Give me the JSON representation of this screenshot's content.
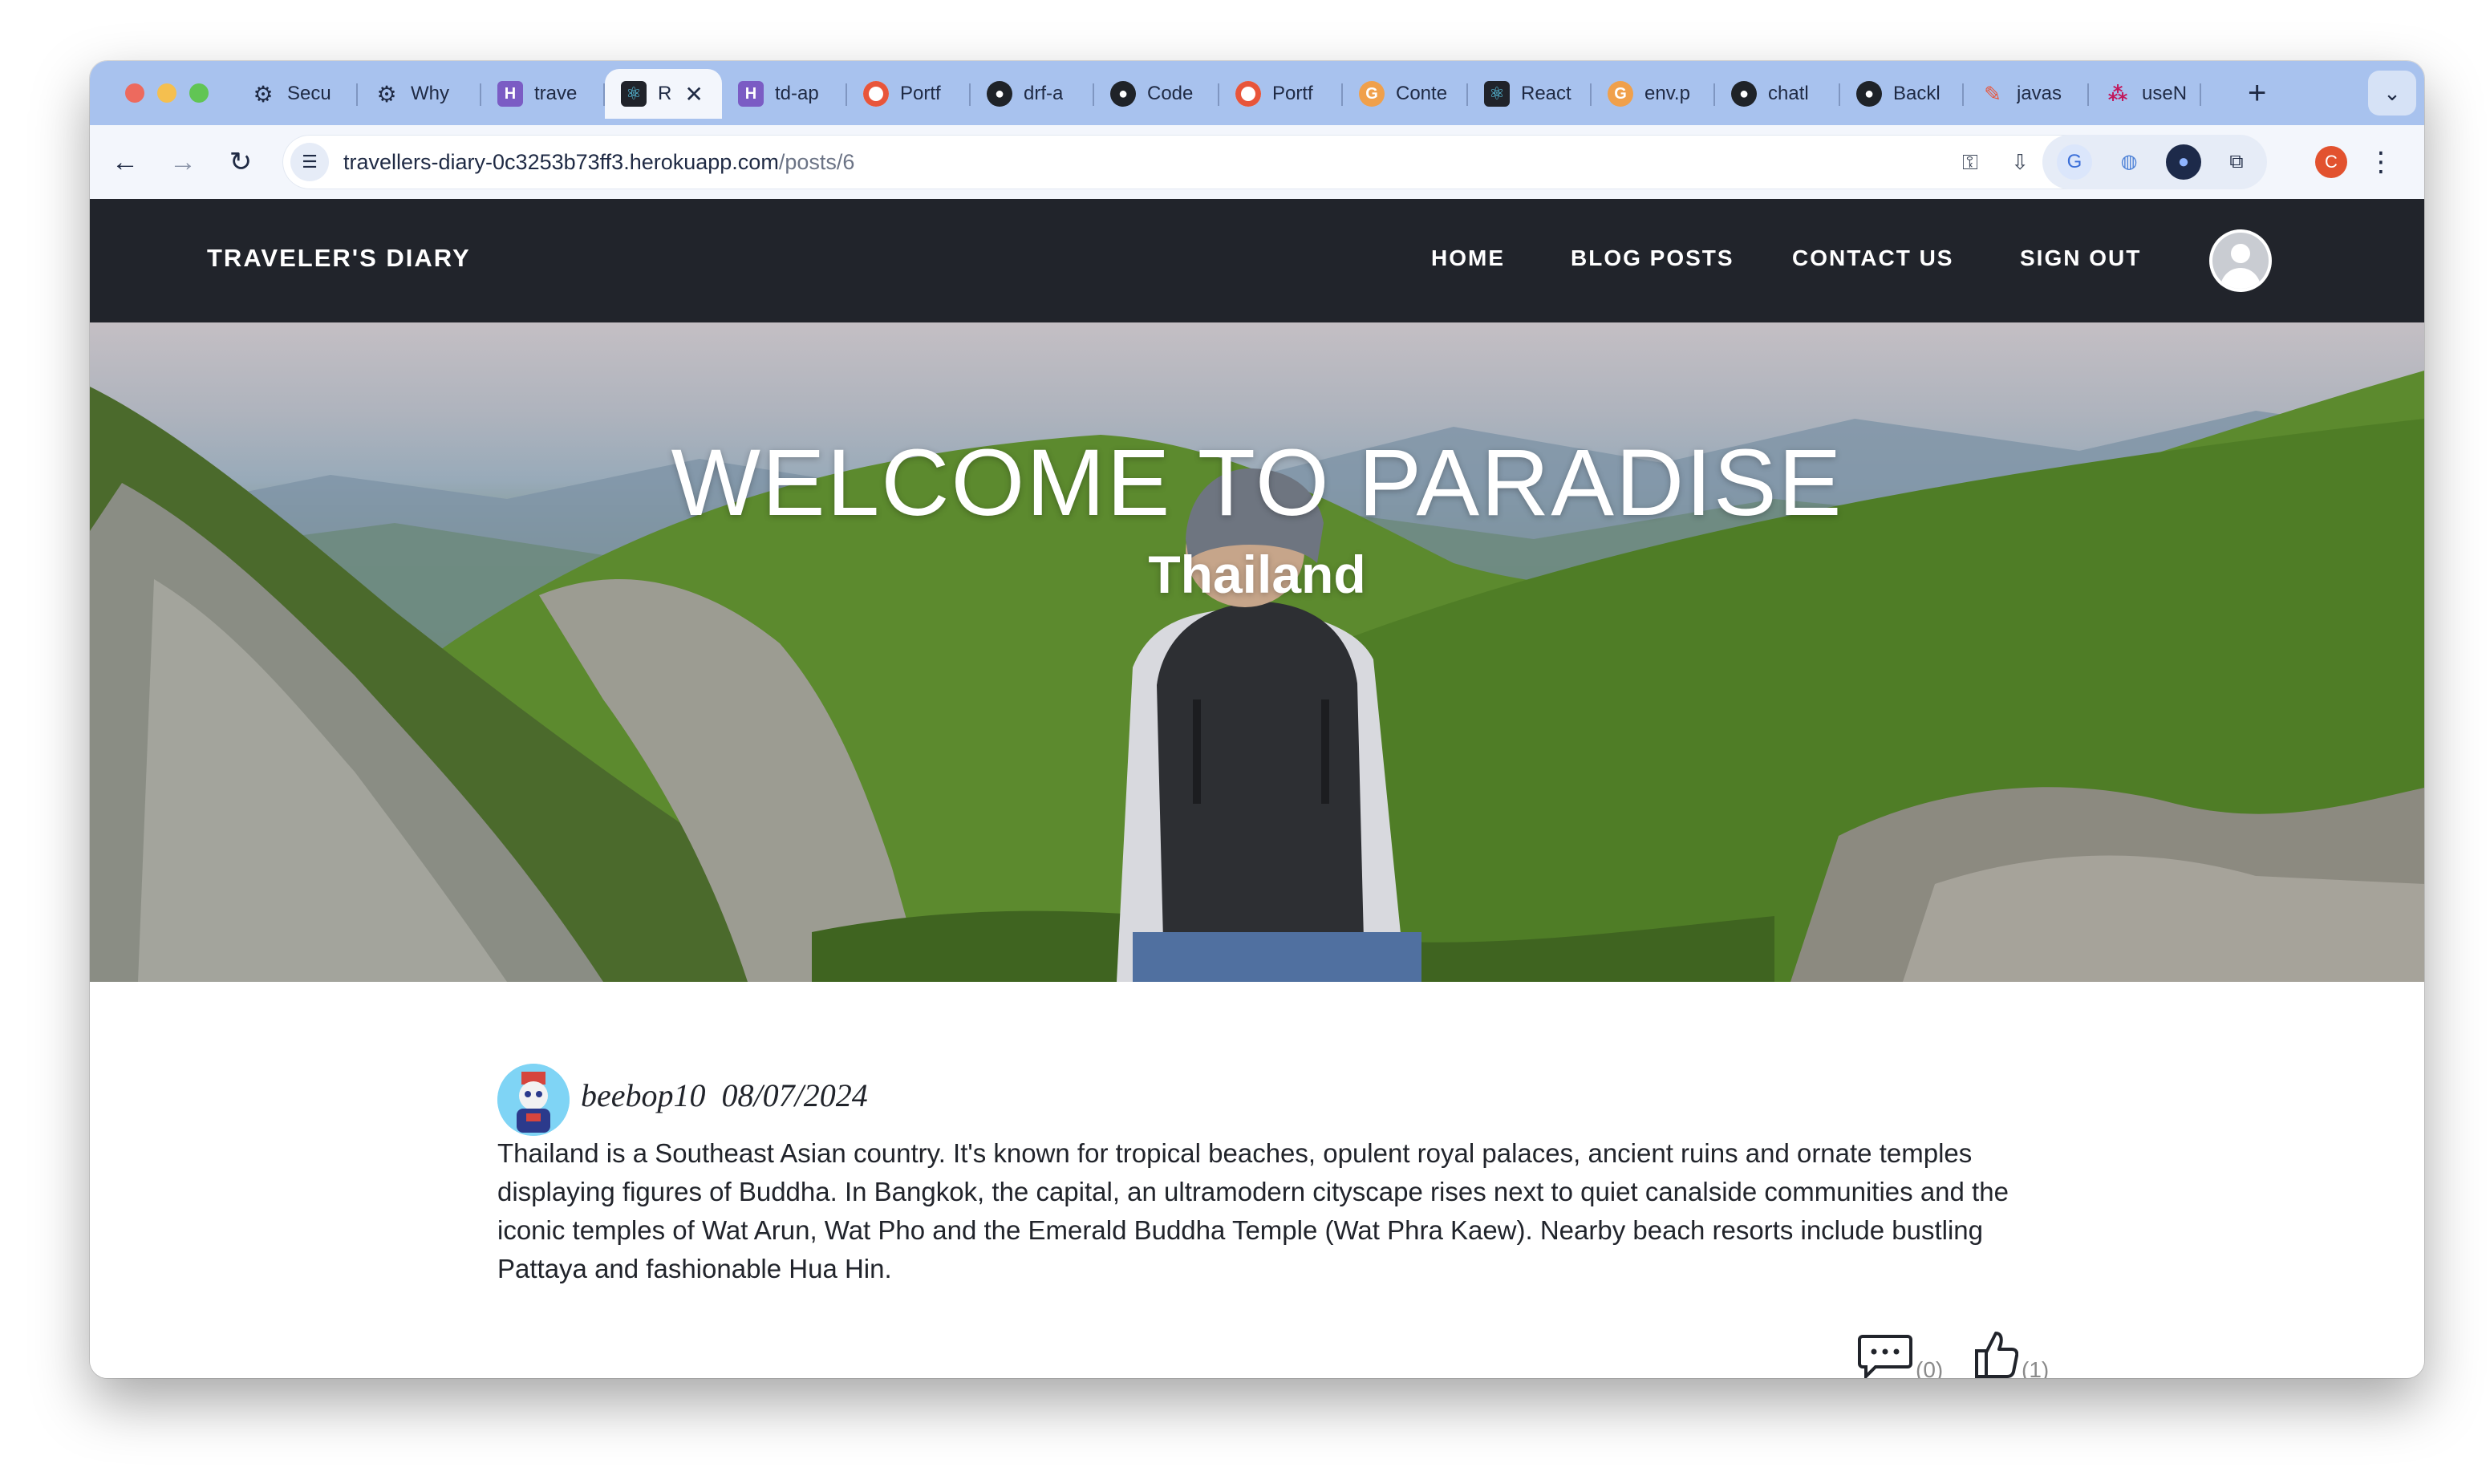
{
  "browser": {
    "tabs": [
      {
        "title": "Secu",
        "icon": "openai-icon"
      },
      {
        "title": "Why",
        "icon": "openai-icon"
      },
      {
        "title": "trave",
        "icon": "heroku-icon"
      },
      {
        "title": "R",
        "icon": "react-icon",
        "active": true
      },
      {
        "title": "td-ap",
        "icon": "heroku-icon"
      },
      {
        "title": "Portf",
        "icon": "ring-icon"
      },
      {
        "title": "drf-a",
        "icon": "github-icon"
      },
      {
        "title": "Code",
        "icon": "github-icon"
      },
      {
        "title": "Portf",
        "icon": "ring-icon"
      },
      {
        "title": "Conte",
        "icon": "orange-g-icon"
      },
      {
        "title": "React",
        "icon": "react-icon"
      },
      {
        "title": "env.p",
        "icon": "orange-g-icon"
      },
      {
        "title": "chatl",
        "icon": "github-icon"
      },
      {
        "title": "Backl",
        "icon": "github-icon"
      },
      {
        "title": "javas",
        "icon": "pen-icon"
      },
      {
        "title": "useN",
        "icon": "dots-icon"
      }
    ],
    "new_tab_symbol": "+",
    "address": {
      "domain": "travellers-diary-0c3253b73ff3.herokuapp.com",
      "path": "/posts/6"
    },
    "profile_initial": "C"
  },
  "site": {
    "brand": "TRAVELER'S DIARY",
    "nav": {
      "home": "HOME",
      "blog_posts": "BLOG POSTS",
      "contact_us": "CONTACT US",
      "sign_out": "SIGN OUT"
    }
  },
  "hero": {
    "title": "WELCOME TO PARADISE",
    "subtitle": "Thailand"
  },
  "post": {
    "author": "beebop10",
    "date": "08/07/2024",
    "body": "Thailand is a Southeast Asian country. It's known for tropical beaches, opulent royal palaces, ancient ruins and ornate temples displaying figures of Buddha. In Bangkok, the capital, an ultramodern cityscape rises next to quiet canalside communities and the iconic temples of Wat Arun, Wat Pho and the Emerald Buddha Temple (Wat Phra Kaew). Nearby beach resorts include bustling Pattaya and fashionable Hua Hin.",
    "comments_count": "(0)",
    "likes_count": "(1)"
  },
  "colors": {
    "navbar": "#21242b",
    "tabstrip": "#a8c2ee",
    "toolbar": "#f3f6fc"
  }
}
